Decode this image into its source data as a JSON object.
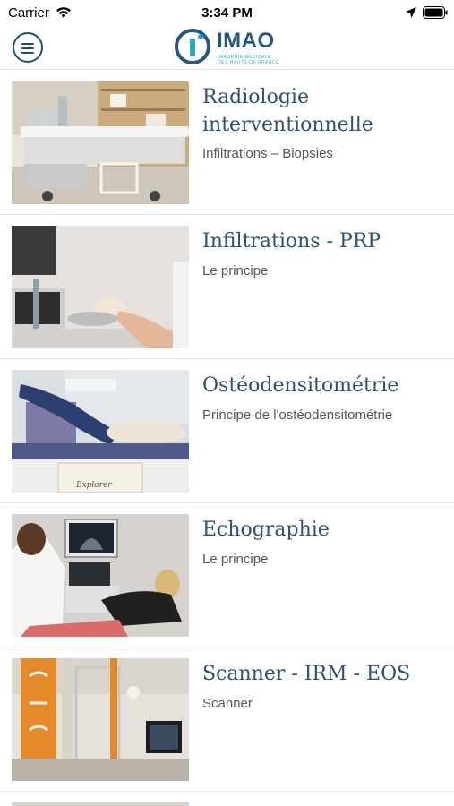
{
  "status_bar": {
    "carrier": "Carrier",
    "time": "3:34 PM"
  },
  "header": {
    "logo_text": "IMAO",
    "logo_tagline_1": "IMAGERIE MÉDICALE",
    "logo_tagline_2": "DES HAUTS-DE-FRANCE",
    "brand_color": "#23587f",
    "accent_color": "#2fa6c8"
  },
  "items": [
    {
      "title": "Radiologie interventionnelle",
      "subtitle": "Infiltrations – Biopsies",
      "image": "radiology-table-photo"
    },
    {
      "title": "Infiltrations - PRP",
      "subtitle": "Le principe",
      "image": "prp-injection-photo"
    },
    {
      "title": "Ostéodensitométrie",
      "subtitle": "Principe de l'ostéodensitométrie",
      "image": "densitometry-photo",
      "image_text": "Explorer"
    },
    {
      "title": "Echographie",
      "subtitle": "Le principe",
      "image": "ultrasound-photo"
    },
    {
      "title": "Scanner - IRM - EOS",
      "subtitle": "Scanner",
      "image": "scanner-eos-photo"
    }
  ]
}
